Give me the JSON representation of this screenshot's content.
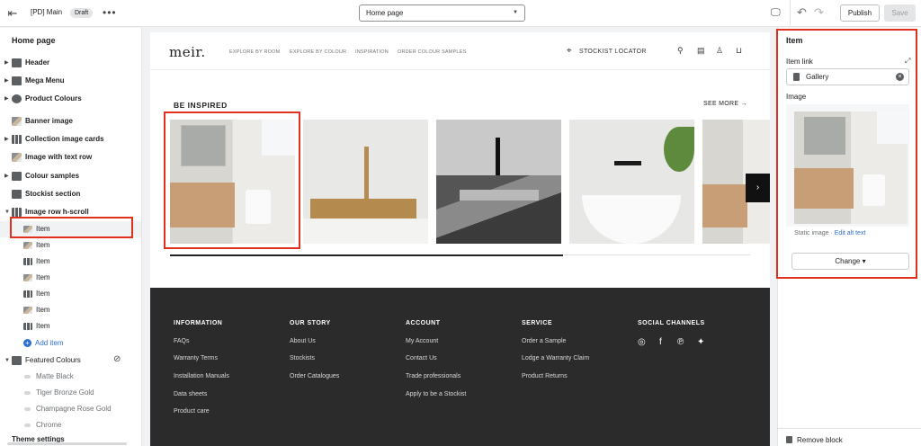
{
  "topbar": {
    "theme_name": "[PD] Main",
    "status_badge": "Draft",
    "more_glyph": "•••",
    "page_select": "Home page",
    "publish_label": "Publish",
    "save_label": "Save"
  },
  "sidebar": {
    "title": "Home page",
    "sections": [
      {
        "label": "Header",
        "icon": "header-icon"
      },
      {
        "label": "Mega Menu",
        "icon": "menu-icon"
      },
      {
        "label": "Product Colours",
        "icon": "palette-icon"
      },
      {
        "label": "Banner image",
        "icon": "image-icon"
      },
      {
        "label": "Collection image cards",
        "icon": "cards-icon"
      },
      {
        "label": "Image with text row",
        "icon": "image-text-icon"
      },
      {
        "label": "Colour samples",
        "icon": "samples-icon"
      },
      {
        "label": "Stockist section",
        "icon": "section-icon"
      },
      {
        "label": "Image row h-scroll",
        "icon": "scroll-icon"
      }
    ],
    "items": [
      "Item",
      "Item",
      "Item",
      "Item",
      "Item",
      "Item",
      "Item"
    ],
    "add_item": "Add item",
    "featured": "Featured Colours",
    "colours": [
      "Matte Black",
      "Tiger Bronze Gold",
      "Champagne Rose Gold",
      "Chrome"
    ],
    "theme_settings": "Theme settings"
  },
  "preview": {
    "logo": "meir.",
    "nav": [
      "EXPLORE BY ROOM",
      "EXPLORE BY COLOUR",
      "INSPIRATION",
      "ORDER COLOUR SAMPLES"
    ],
    "stockist": "STOCKIST LOCATOR",
    "section_title": "BE INSPIRED",
    "see_more": "SEE MORE",
    "footer": {
      "cols": [
        {
          "heading": "INFORMATION",
          "links": [
            "FAQs",
            "Warranty Terms",
            "Installation Manuals",
            "Data sheets",
            "Product care"
          ]
        },
        {
          "heading": "OUR STORY",
          "links": [
            "About Us",
            "Stockists",
            "Order Catalogues"
          ]
        },
        {
          "heading": "ACCOUNT",
          "links": [
            "My Account",
            "Contact Us",
            "Trade professionals",
            "Apply to be a Stockist"
          ]
        },
        {
          "heading": "SERVICE",
          "links": [
            "Order a Sample",
            "Lodge a Warranty Claim",
            "Product Returns"
          ]
        },
        {
          "heading": "SOCIAL CHANNELS",
          "links": []
        }
      ]
    }
  },
  "panel": {
    "title": "Item",
    "item_link_label": "Item link",
    "item_link_value": "Gallery",
    "image_label": "Image",
    "static_text": "Static image",
    "edit_alt": "Edit alt text",
    "change_label": "Change",
    "remove_label": "Remove block"
  },
  "colors": {
    "accent_highlight": "#e0301e",
    "link_blue": "#2c6ecb",
    "footer_bg": "#2b2b2b"
  }
}
